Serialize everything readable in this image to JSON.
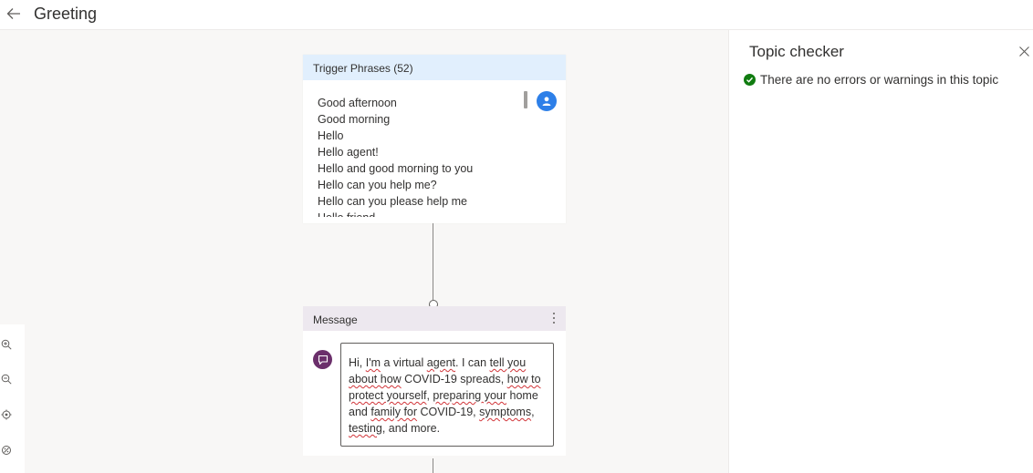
{
  "header": {
    "back_icon": "arrow-left-icon",
    "title": "Greeting"
  },
  "trigger_card": {
    "title": "Trigger Phrases (52)",
    "icon": "user-icon",
    "phrases": [
      "Good afternoon",
      "Good morning",
      "Hello",
      "Hello agent!",
      "Hello and good morning to you",
      "Hello can you help me?",
      "Hello can you please help me",
      "Hello friend"
    ]
  },
  "message_card": {
    "title": "Message",
    "icon": "chat-bubble-icon",
    "text": "Hi, I'm a virtual agent. I can tell you about how COVID-19 spreads, how to protect yourself, preparing your home and family for COVID-19, symptoms, testing, and more."
  },
  "zoom_controls": [
    "zoom-in-icon",
    "zoom-out-icon",
    "recenter-icon",
    "minimap-icon"
  ],
  "panel": {
    "title": "Topic checker",
    "close_icon": "close-icon",
    "status_icon": "check-circle-icon",
    "status_text": "There are no errors or warnings in this topic"
  },
  "colors": {
    "trigger_header": "#e1effd",
    "message_header": "#ede8ef",
    "user_icon": "#2d7fe8",
    "chat_icon": "#6b2f6b",
    "success": "#107c10",
    "canvas_bg": "#f8f7f6"
  }
}
